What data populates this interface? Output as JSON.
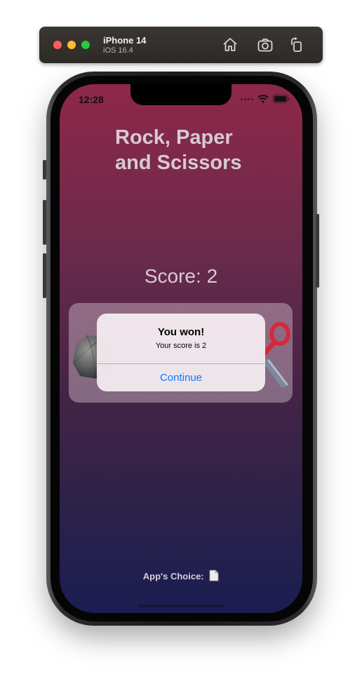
{
  "simulator": {
    "device_name": "iPhone 14",
    "os_version": "iOS 16.4",
    "icons": [
      "home-icon",
      "screenshot-icon",
      "rotate-icon"
    ]
  },
  "status_bar": {
    "time": "12:28"
  },
  "app": {
    "title": "Rock, Paper and Scissors",
    "score_text": "Score: 2",
    "choices": [
      "rock-icon",
      "scissors-icon"
    ],
    "app_choice_label": "App's Choice:",
    "app_choice_icon": "paper-icon",
    "colors": {
      "gradient_top": "#8e2848",
      "gradient_bottom": "#1b1d52"
    }
  },
  "alert": {
    "title": "You won!",
    "message": "Your score is 2",
    "button_label": "Continue",
    "button_color": "#0a7aff"
  }
}
